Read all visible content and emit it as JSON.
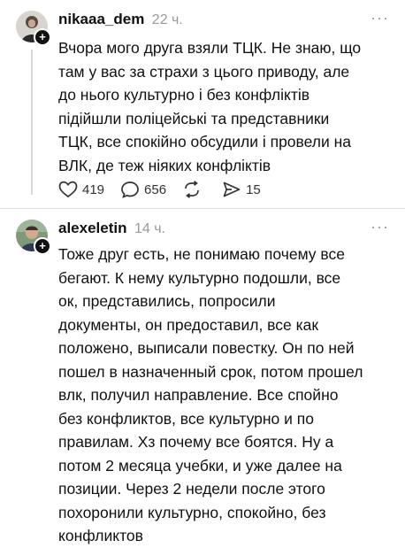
{
  "post1": {
    "username": "nikaaa_dem",
    "time": "22 ч.",
    "more_label": "···",
    "text": "Вчора мого друга взяли ТЦК. Не знаю, що\nтам у вас за страхи з цього приводу, але\nдо нього культурно і без конфліктів\nпідійшли поліцейські та представники\nТЦК, все спокійно обсудили і провели на\nВЛК, де теж ніяких конфліктів",
    "likes": "419",
    "comments": "656",
    "shares": "15"
  },
  "post2": {
    "username": "alexeletin",
    "time": "14 ч.",
    "more_label": "···",
    "text": "Тоже друг есть, не понимаю почему все\nбегают. К нему культурно подошли, все\nок, представились, попросили\nдокументы, он предоставил, все как\nположено, выписали повестку. Он по ней\nпошел в назначенный срок, потом прошел\nвлк, получил направление. Все спойно\nбез конфликтов, все культурно и по\nправилам. Хз почему все боятся. Ну а\nпотом 2 месяца учебки, и уже далее на\nпозиции. Через 2 недели после этого\nпохоронили культурно, спокойно, без\nконфликтов"
  },
  "icons": [
    "plus-icon",
    "heart-icon",
    "comment-icon",
    "repost-icon",
    "share-icon",
    "more-icon"
  ],
  "colors": {
    "text": "#111111",
    "muted": "#9a9a9a",
    "badge": "#111111"
  }
}
